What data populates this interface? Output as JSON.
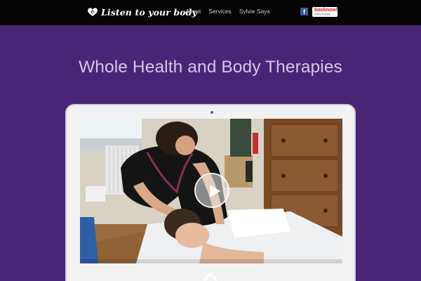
{
  "header": {
    "logo_text": "Listen to your body",
    "nav": [
      "About",
      "Services",
      "Sylvie Says"
    ],
    "facebook_glyph": "f",
    "booknow_main": "booknow!",
    "booknow_sub": "online booking"
  },
  "hero": {
    "title": "Whole Health and Body Therapies"
  },
  "icons": {
    "logo": "heart-spiral-icon",
    "social": "facebook-icon",
    "booking": "booknow-badge",
    "play": "play-icon",
    "scroll": "chevron-up-icon"
  },
  "colors": {
    "page_background": "#4a2577",
    "topbar": "#050505",
    "headline": "#d3c6ea",
    "booknow_red": "#d11b1b",
    "facebook_blue": "#3b5998",
    "laptop_frame": "#f2f2f2"
  }
}
